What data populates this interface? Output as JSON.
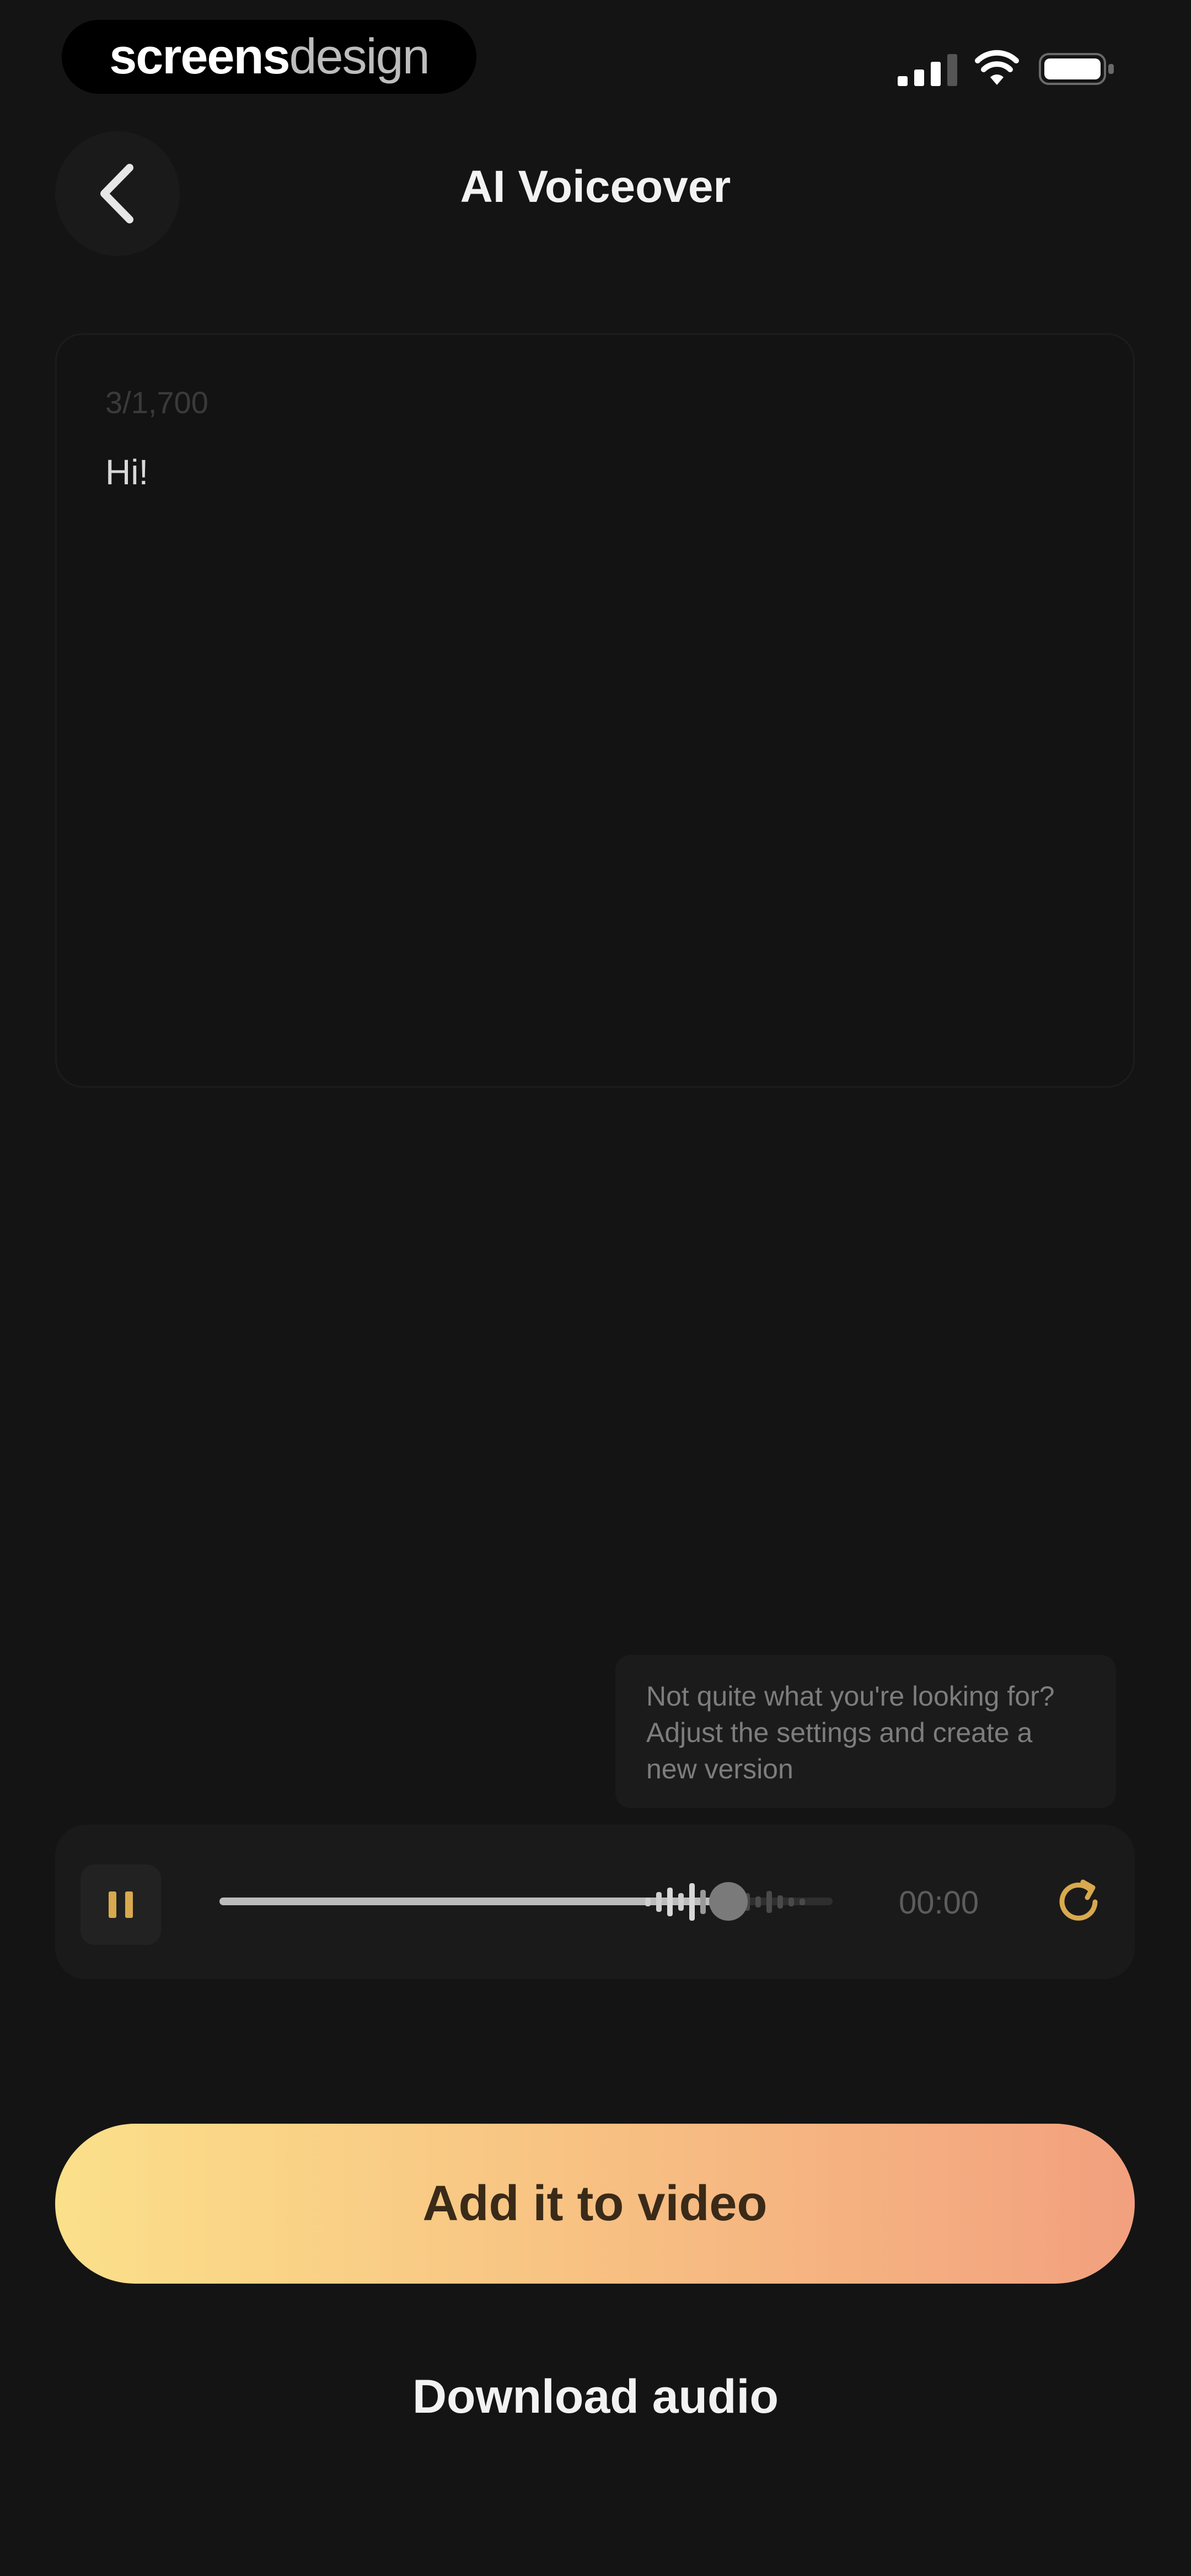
{
  "status_bar": {
    "brand_bold": "screens",
    "brand_light": "design"
  },
  "header": {
    "title": "AI Voiceover"
  },
  "editor": {
    "char_count": "3/1,700",
    "text": "Hi!"
  },
  "tooltip": {
    "text": "Not quite what you're looking for? Adjust the settings and create a new version"
  },
  "player": {
    "progress": 0.83,
    "time": "00:00"
  },
  "actions": {
    "primary_label": "Add it to video",
    "secondary_label": "Download audio"
  },
  "colors": {
    "background": "#141414",
    "accent_gold": "#d8a94e",
    "gradient_start": "#fbe08a",
    "gradient_end": "#f2a07e"
  },
  "icons": {
    "back": "chevron-left-icon",
    "pause": "pause-icon",
    "refresh": "refresh-icon",
    "signal": "cellular-signal-icon",
    "wifi": "wifi-icon",
    "battery": "battery-icon"
  }
}
